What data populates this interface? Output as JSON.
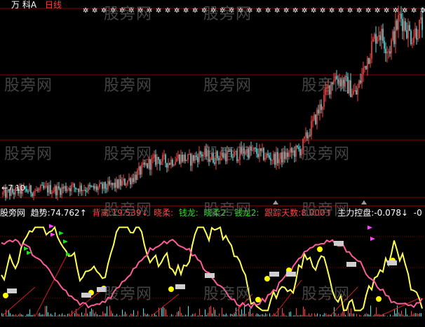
{
  "window": {
    "stock_name": "万 科A",
    "period": "日线",
    "price_low_label": "←7.10",
    "footer_brand": "股旁网"
  },
  "indicator_bar": {
    "label_prefix": "股旁网",
    "items": [
      {
        "name": "趋势:",
        "value": "74.762",
        "arrow": "↑",
        "color": "#ffffff"
      },
      {
        "name": "背离:",
        "value": "19.539",
        "arrow": "↓",
        "color": "#ff4444"
      },
      {
        "name": "晓柔:",
        "value": "",
        "arrow": "",
        "color": "#ff4444"
      },
      {
        "name": "钱龙:",
        "value": "",
        "arrow": "",
        "color": "#22dd22"
      },
      {
        "name": "晓柔2:",
        "value": "",
        "arrow": "",
        "color": "#22dd22"
      },
      {
        "name": "钱龙2:",
        "value": "",
        "arrow": "",
        "color": "#22dd22"
      },
      {
        "name": "跟踪天数:",
        "value": "8.000",
        "arrow": "↑",
        "color": "#ff4444"
      },
      {
        "name": "主力控盘:",
        "value": "-0.078",
        "arrow": "↓",
        "color": "#ffffff"
      },
      {
        "name": "",
        "value": "-0",
        "arrow": "",
        "color": "#ffffff"
      }
    ]
  },
  "watermark": {
    "text": "股旁网"
  },
  "colors": {
    "background": "#000000",
    "grid": "#8b0000",
    "candle_up": "#ff4040",
    "candle_down": "#55e0e0",
    "trend_line": "#ffff55",
    "divergence_line": "#ff5c9a",
    "signal_dot": "#ffff00",
    "marker_green": "#22dd22",
    "marker_magenta": "#ff44ff"
  },
  "chart_data": [
    {
      "type": "candlestick",
      "title": "万 科A 日线",
      "ylabel": "",
      "y_min_label": "7.10",
      "close_trend": [
        7.1,
        7.3,
        7.5,
        7.4,
        7.6,
        7.5,
        7.8,
        7.7,
        7.6,
        7.7,
        7.9,
        8.2,
        8.8,
        9.8,
        10.4,
        10.1,
        10.6,
        10.3,
        10.9,
        10.5,
        10.8,
        10.7,
        11.2,
        11.0,
        10.6,
        10.4,
        10.9,
        11.3,
        13.5,
        15.8,
        18.2,
        17.5,
        16.4,
        19.8,
        22.5,
        20.6,
        23.8,
        21.9,
        23.0
      ],
      "ylim": [
        6.8,
        24.5
      ]
    },
    {
      "type": "line",
      "title": "",
      "series": [
        {
          "name": "趋势",
          "last": 74.762
        },
        {
          "name": "背离",
          "last": 19.539
        }
      ],
      "ylim": [
        0,
        100
      ]
    }
  ]
}
